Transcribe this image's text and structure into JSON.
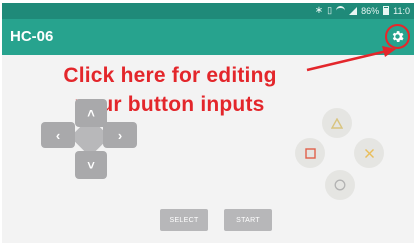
{
  "statusbar": {
    "battery_text": "86%",
    "time": "11:0"
  },
  "toolbar": {
    "title": "HC-06"
  },
  "annotation": {
    "line1": "Click here for editing",
    "line2": "your button inputs",
    "color": "#e3262b"
  },
  "dpad": {
    "up_symbol": "˄",
    "down_symbol": "˅",
    "left_symbol": "‹",
    "right_symbol": "›"
  },
  "face_buttons": {
    "triangle_color": "#d9c47e",
    "square_color": "#e0604a",
    "cross_color": "#e9be5b",
    "circle_color": "#b3b3b3"
  },
  "buttons": {
    "select_label": "SELECT",
    "start_label": "START"
  },
  "colors": {
    "statusbar": "#1f8a79",
    "toolbar": "#27a38e",
    "background": "#f3f3f3",
    "dpad": "#a9a9ab"
  }
}
